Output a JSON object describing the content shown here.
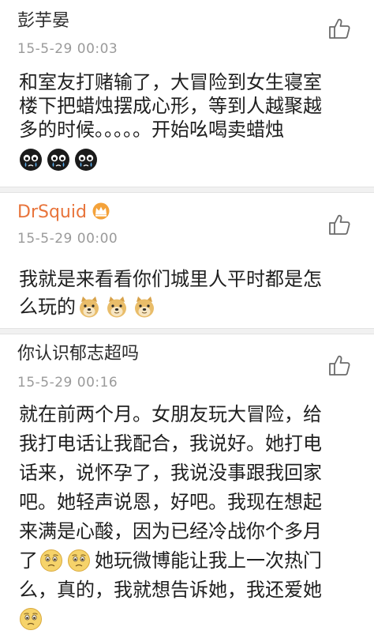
{
  "comments": [
    {
      "username": "彭芋晏",
      "timestamp": "15-5-29 00:03",
      "lines": [
        "和室友打赌输了，大冒险到女生寝室",
        "楼下把蜡烛摆成心形，等到人越聚越",
        "多的时候。。。。。开始吆喝卖蜡烛"
      ],
      "emoji_row": [
        "cry-mask-icon",
        "cry-mask-icon",
        "cry-mask-icon"
      ]
    },
    {
      "username": "DrSquid",
      "badge": "vip-crown-icon",
      "timestamp": "15-5-29 00:00",
      "lines": [
        "我就是来看看你们城里人平时都是怎",
        "么玩的"
      ],
      "emoji_inline": [
        "doge-icon",
        "doge-icon",
        "doge-icon"
      ]
    },
    {
      "username": "你认识郁志超吗",
      "timestamp": "15-5-29 00:16",
      "lines": [
        "就在前两个月。女朋友玩大冒险，给",
        "我打电话让我配合，我说好。她打电",
        "话来，说怀孕了，我说没事跟我回家",
        "吧。她轻声说恩，好吧。我现在想起",
        "来满是心酸，因为已经冷战你个多月",
        "了",
        "她玩微博能让我上一次热门",
        "么，真的，我就想告诉她，我还爱她"
      ],
      "emoji_inline": [
        "sad-face-icon",
        "sad-face-icon"
      ],
      "emoji_row": [
        "sad-face-icon"
      ]
    }
  ],
  "colors": {
    "username_normal": "#2b2b2b",
    "username_vip": "#e8743b",
    "timestamp": "#9a9a9a",
    "divider": "#f1f1f1"
  },
  "icons": {
    "like": "thumbs-up-icon"
  }
}
